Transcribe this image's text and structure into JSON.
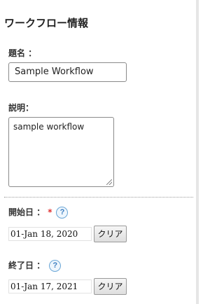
{
  "section_title": "ワークフロー情報",
  "fields": {
    "title": {
      "label": "題名 ：",
      "value": "Sample Workflow"
    },
    "description": {
      "label": "説明：",
      "value": "sample workflow"
    },
    "start_date": {
      "label": "開始日 ：",
      "required_mark": "*",
      "help": "?",
      "value": "01-Jan 18, 2020",
      "clear_label": "クリア"
    },
    "end_date": {
      "label": "終了日 ：",
      "help": "?",
      "value": "01-Jan 17, 2021",
      "clear_label": "クリア"
    }
  }
}
